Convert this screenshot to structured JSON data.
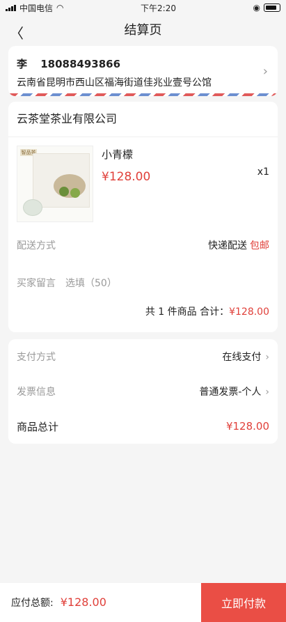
{
  "status_bar": {
    "carrier": "中国电信",
    "time": "下午2:20"
  },
  "header": {
    "title": "结算页"
  },
  "address": {
    "name": "李",
    "phone": "18088493866",
    "detail": "云南省昆明市西山区福海街道佳兆业壹号公馆"
  },
  "shop": {
    "name": "云茶堂茶业有限公司",
    "product": {
      "name": "小青檬",
      "price": "¥128.00",
      "qty": "x1",
      "thumb_logo": "智品茶"
    },
    "delivery_label": "配送方式",
    "delivery_value": "快递配送",
    "delivery_free": "包邮",
    "message_label": "买家留言",
    "message_placeholder": "选填（50）",
    "summary_prefix": "共 1 件商品  合计：",
    "summary_amount": "¥128.00"
  },
  "payment": {
    "method_label": "支付方式",
    "method_value": "在线支付",
    "invoice_label": "发票信息",
    "invoice_value": "普通发票-个人",
    "total_label": "商品总计",
    "total_value": "¥128.00"
  },
  "bottom": {
    "due_label": "应付总额:",
    "due_amount": "¥128.00",
    "pay_button": "立即付款"
  },
  "colors": {
    "accent": "#ea4e45",
    "price": "#e0403a"
  }
}
